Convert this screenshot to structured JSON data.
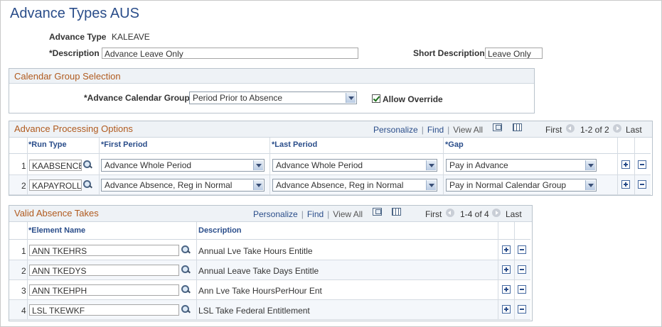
{
  "page": {
    "title": "Advance Types AUS"
  },
  "header": {
    "advance_type_label": "Advance Type",
    "advance_type_value": "KALEAVE",
    "description_label": "*Description",
    "description_value": "Advance Leave Only",
    "short_description_label": "Short Description",
    "short_description_value": "Leave Only"
  },
  "calendar_group": {
    "title": "Calendar Group Selection",
    "label": "*Advance Calendar Group",
    "selected": "Period Prior to Absence",
    "allow_override_label": "Allow Override",
    "allow_override_checked": true
  },
  "processing": {
    "title": "Advance Processing Options",
    "nav": {
      "personalize": "Personalize",
      "find": "Find",
      "view_all": "View All",
      "first": "First",
      "range": "1-2 of 2",
      "last": "Last"
    },
    "columns": {
      "run_type": "*Run Type",
      "first_period": "*First Period",
      "last_period": "*Last Period",
      "gap": "*Gap"
    },
    "rows": [
      {
        "num": "1",
        "run_type": "KAABSENCE",
        "first_period": "Advance Whole Period",
        "last_period": "Advance Whole Period",
        "gap": "Pay in Advance"
      },
      {
        "num": "2",
        "run_type": "KAPAYROLL",
        "first_period": "Advance Absence, Reg in Normal",
        "last_period": "Advance Absence, Reg in Normal",
        "gap": "Pay in Normal Calendar Group"
      }
    ]
  },
  "absence": {
    "title": "Valid Absence Takes",
    "nav": {
      "personalize": "Personalize",
      "find": "Find",
      "view_all": "View All",
      "first": "First",
      "range": "1-4 of 4",
      "last": "Last"
    },
    "columns": {
      "element_name": "*Element Name",
      "description": "Description"
    },
    "rows": [
      {
        "num": "1",
        "element": "ANN TKEHRS",
        "description": "Annual Lve Take Hours Entitle"
      },
      {
        "num": "2",
        "element": "ANN TKEDYS",
        "description": "Annual Leave Take Days Entitle"
      },
      {
        "num": "3",
        "element": "ANN TKEHPH",
        "description": "Ann Lve Take HoursPerHour Ent"
      },
      {
        "num": "4",
        "element": "LSL TKEWKF",
        "description": "LSL Take Federal Entitlement"
      }
    ]
  }
}
